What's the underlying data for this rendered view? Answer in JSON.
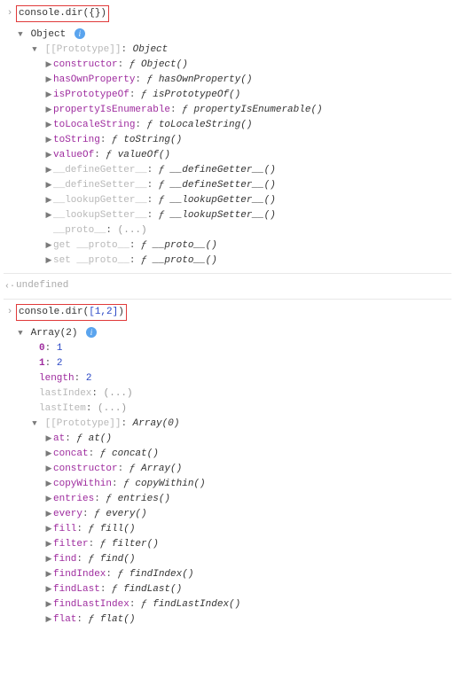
{
  "entry1": {
    "gutter": "›",
    "command": "console.dir({})",
    "header": "Object",
    "protoLabel": "[[Prototype]]",
    "protoValue": "Object",
    "protoItems": [
      {
        "name": "constructor",
        "value": "Object()",
        "kind": "fn"
      },
      {
        "name": "hasOwnProperty",
        "value": "hasOwnProperty()",
        "kind": "fn"
      },
      {
        "name": "isPrototypeOf",
        "value": "isPrototypeOf()",
        "kind": "fn"
      },
      {
        "name": "propertyIsEnumerable",
        "value": "propertyIsEnumerable()",
        "kind": "fn"
      },
      {
        "name": "toLocaleString",
        "value": "toLocaleString()",
        "kind": "fn"
      },
      {
        "name": "toString",
        "value": "toString()",
        "kind": "fn"
      },
      {
        "name": "valueOf",
        "value": "valueOf()",
        "kind": "fn"
      },
      {
        "name": "__defineGetter__",
        "value": "__defineGetter__()",
        "kind": "fn-dim"
      },
      {
        "name": "__defineSetter__",
        "value": "__defineSetter__()",
        "kind": "fn-dim"
      },
      {
        "name": "__lookupGetter__",
        "value": "__lookupGetter__()",
        "kind": "fn-dim"
      },
      {
        "name": "__lookupSetter__",
        "value": "__lookupSetter__()",
        "kind": "fn-dim"
      },
      {
        "name": "__proto__",
        "value": "(...)",
        "kind": "dim-plain",
        "no_arrow": true
      },
      {
        "name": "get __proto__",
        "value": "__proto__()",
        "kind": "fn-dim"
      },
      {
        "name": "set __proto__",
        "value": "__proto__()",
        "kind": "fn-dim"
      }
    ]
  },
  "result1": {
    "gutter": "‹·",
    "text": "undefined"
  },
  "entry2": {
    "gutter": "›",
    "command_prefix": "console.dir(",
    "command_args": "[1,2]",
    "command_suffix": ")",
    "header": "Array(2)",
    "items": [
      {
        "name": "0",
        "value": "1",
        "kind": "num"
      },
      {
        "name": "1",
        "value": "2",
        "kind": "num"
      },
      {
        "name": "length",
        "value": "2",
        "kind": "num"
      },
      {
        "name": "lastIndex",
        "value": "(...)",
        "kind": "dim-plain"
      },
      {
        "name": "lastItem",
        "value": "(...)",
        "kind": "dim-plain"
      }
    ],
    "protoLabel": "[[Prototype]]",
    "protoValue": "Array(0)",
    "protoItems": [
      {
        "name": "at",
        "value": "at()",
        "kind": "fn"
      },
      {
        "name": "concat",
        "value": "concat()",
        "kind": "fn"
      },
      {
        "name": "constructor",
        "value": "Array()",
        "kind": "fn"
      },
      {
        "name": "copyWithin",
        "value": "copyWithin()",
        "kind": "fn"
      },
      {
        "name": "entries",
        "value": "entries()",
        "kind": "fn"
      },
      {
        "name": "every",
        "value": "every()",
        "kind": "fn"
      },
      {
        "name": "fill",
        "value": "fill()",
        "kind": "fn"
      },
      {
        "name": "filter",
        "value": "filter()",
        "kind": "fn"
      },
      {
        "name": "find",
        "value": "find()",
        "kind": "fn"
      },
      {
        "name": "findIndex",
        "value": "findIndex()",
        "kind": "fn"
      },
      {
        "name": "findLast",
        "value": "findLast()",
        "kind": "fn"
      },
      {
        "name": "findLastIndex",
        "value": "findLastIndex()",
        "kind": "fn"
      },
      {
        "name": "flat",
        "value": "flat()",
        "kind": "fn"
      }
    ]
  },
  "glyphs": {
    "down": "▼",
    "right": "▶",
    "f": "ƒ",
    "info": "i"
  }
}
